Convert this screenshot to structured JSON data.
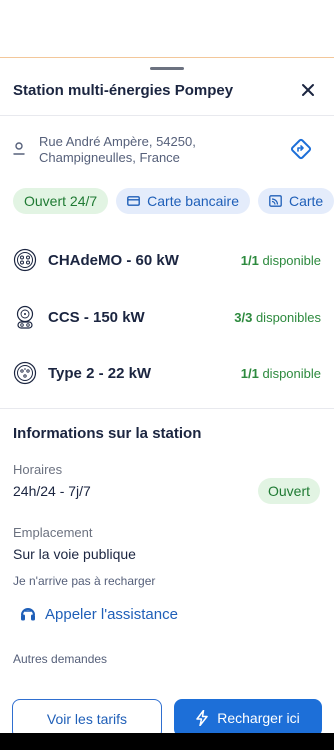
{
  "station": {
    "title": "Station multi-énergies Pompey",
    "address_line1": "Rue André Ampère, 54250,",
    "address_line2": "Champigneulles, France"
  },
  "chips": [
    {
      "label": "Ouvert 24/7",
      "icon": null
    },
    {
      "label": "Carte bancaire",
      "icon": "credit-card-icon"
    },
    {
      "label": "Carte",
      "icon": "rfid-card-icon"
    }
  ],
  "connectors": [
    {
      "name": "CHAdeMO - 60 kW",
      "available": "1/1",
      "available_label": "disponible",
      "icon": "chademo-plug-icon"
    },
    {
      "name": "CCS - 150 kW",
      "available": "3/3",
      "available_label": "disponibles",
      "icon": "ccs-plug-icon"
    },
    {
      "name": "Type 2 - 22 kW",
      "available": "1/1",
      "available_label": "disponible",
      "icon": "type2-plug-icon"
    }
  ],
  "info": {
    "section_title": "Informations sur la station",
    "hours_label": "Horaires",
    "hours_value": "24h/24 - 7j/7",
    "status": "Ouvert",
    "location_label": "Emplacement",
    "location_value": "Sur la voie publique",
    "cant_charge_label": "Je n'arrive pas à recharger",
    "assistance_label": "Appeler l'assistance",
    "other_requests_label": "Autres demandes"
  },
  "actions": {
    "tariffs_label": "Voir les tarifs",
    "recharge_label": "Recharger ici"
  },
  "colors": {
    "primary": "#1d6fd8",
    "green": "#2d8a3e",
    "green_bg": "#e2f4e3",
    "blue_bg": "#e4ecfb",
    "text": "#1b2540"
  }
}
